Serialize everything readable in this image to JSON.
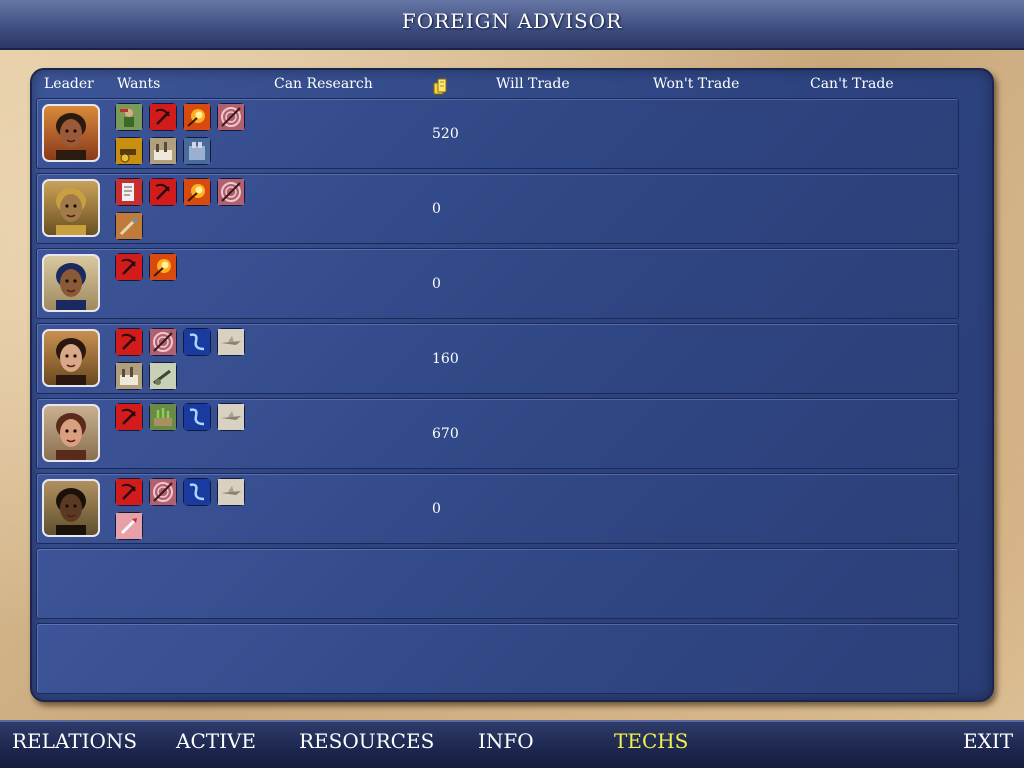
{
  "title": "FOREIGN ADVISOR",
  "columns": {
    "leader": "Leader",
    "wants": "Wants",
    "can_research": "Can Research",
    "gold_icon": "gold-coins-icon",
    "will_trade": "Will Trade",
    "wont_trade": "Won't Trade",
    "cant_trade": "Can't Trade"
  },
  "rows": [
    {
      "leader_icon": "leader-portrait-1",
      "wants": [
        "soldier-tech-icon",
        "hammer-sickle-tech-icon",
        "fire-tech-icon",
        "wheel-tech-icon",
        "cannon-tech-icon",
        "factory-tech-icon",
        "machine-tech-icon"
      ],
      "gold": "520"
    },
    {
      "leader_icon": "leader-portrait-2",
      "wants": [
        "scroll-tech-icon",
        "hammer-sickle-tech-icon",
        "fire-tech-icon",
        "wheel-tech-icon",
        "tools-tech-icon"
      ],
      "gold": "0"
    },
    {
      "leader_icon": "leader-portrait-3",
      "wants": [
        "hammer-sickle-tech-icon",
        "fire-tech-icon"
      ],
      "gold": "0"
    },
    {
      "leader_icon": "leader-portrait-4",
      "wants": [
        "hammer-sickle-tech-icon",
        "wheel-tech-icon",
        "electricity-tech-icon",
        "airplane-tech-icon",
        "factory-tech-icon",
        "artillery-tech-icon"
      ],
      "gold": "160"
    },
    {
      "leader_icon": "leader-portrait-5",
      "wants": [
        "hammer-sickle-tech-icon",
        "plant-tech-icon",
        "electricity-tech-icon",
        "airplane-tech-icon"
      ],
      "gold": "670"
    },
    {
      "leader_icon": "leader-portrait-6",
      "wants": [
        "hammer-sickle-tech-icon",
        "wheel-tech-icon",
        "electricity-tech-icon",
        "airplane-tech-icon",
        "rocket-tech-icon"
      ],
      "gold": "0"
    },
    {
      "empty": true
    },
    {
      "empty": true
    }
  ],
  "nav": {
    "relations": "RELATIONS",
    "active": "ACTIVE",
    "resources": "RESOURCES",
    "info": "INFO",
    "techs": "TECHS",
    "exit": "EXIT"
  },
  "colors": {
    "active_tab": "#f2f04a",
    "panel_blue": "#2d4380",
    "parchment": "#d8bc91"
  }
}
